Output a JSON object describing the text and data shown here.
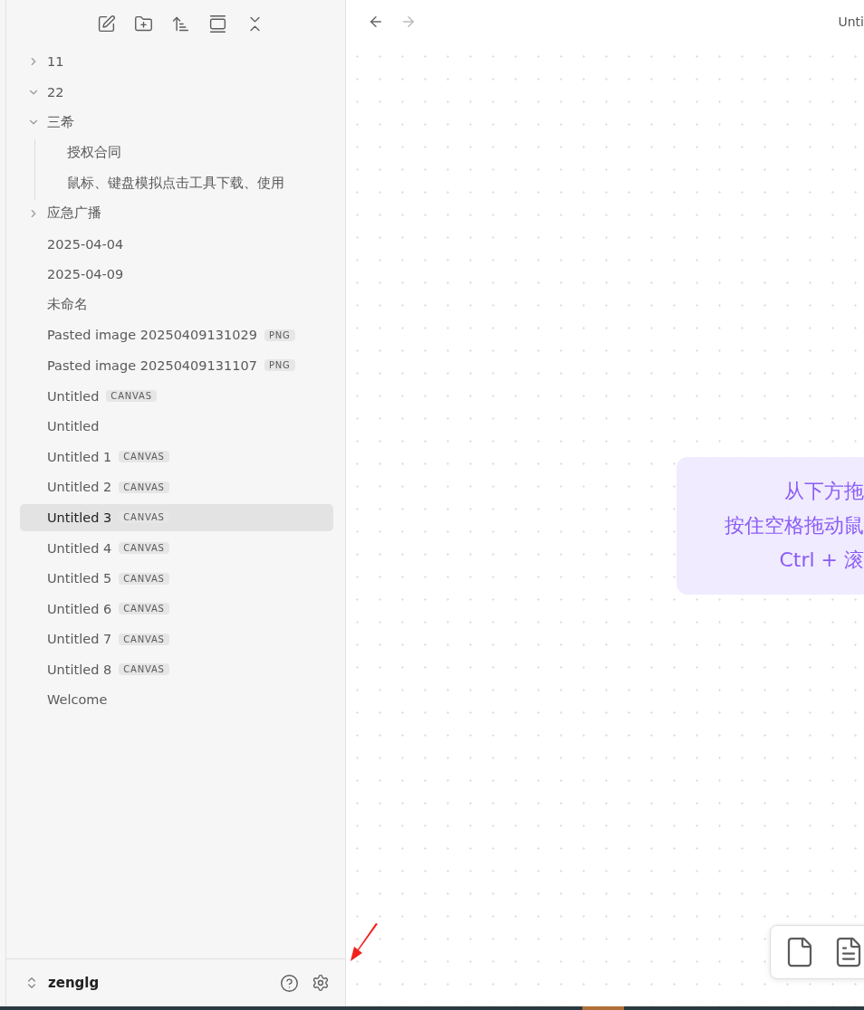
{
  "sidebar": {
    "tree": [
      {
        "kind": "folder",
        "name": "11",
        "expanded": false,
        "selected": false
      },
      {
        "kind": "folder",
        "name": "22",
        "expanded": true,
        "selected": false
      },
      {
        "kind": "folder",
        "name": "三希",
        "expanded": true,
        "selected": false,
        "children": [
          {
            "kind": "file",
            "name": "授权合同",
            "selected": false
          },
          {
            "kind": "file",
            "name": "鼠标、键盘模拟点击工具下载、使用",
            "selected": false
          }
        ]
      },
      {
        "kind": "folder",
        "name": "应急广播",
        "expanded": false,
        "selected": false
      },
      {
        "kind": "file",
        "name": "2025-04-04",
        "selected": false
      },
      {
        "kind": "file",
        "name": "2025-04-09",
        "selected": false
      },
      {
        "kind": "file",
        "name": "未命名",
        "selected": false
      },
      {
        "kind": "file",
        "name": "Pasted image 20250409131029",
        "badge": "PNG",
        "selected": false
      },
      {
        "kind": "file",
        "name": "Pasted image 20250409131107",
        "badge": "PNG",
        "selected": false
      },
      {
        "kind": "file",
        "name": "Untitled",
        "badge": "CANVAS",
        "selected": false
      },
      {
        "kind": "file",
        "name": "Untitled",
        "selected": false
      },
      {
        "kind": "file",
        "name": "Untitled 1",
        "badge": "CANVAS",
        "selected": false
      },
      {
        "kind": "file",
        "name": "Untitled 2",
        "badge": "CANVAS",
        "selected": false
      },
      {
        "kind": "file",
        "name": "Untitled 3",
        "badge": "CANVAS",
        "selected": true
      },
      {
        "kind": "file",
        "name": "Untitled 4",
        "badge": "CANVAS",
        "selected": false
      },
      {
        "kind": "file",
        "name": "Untitled 5",
        "badge": "CANVAS",
        "selected": false
      },
      {
        "kind": "file",
        "name": "Untitled 6",
        "badge": "CANVAS",
        "selected": false
      },
      {
        "kind": "file",
        "name": "Untitled 7",
        "badge": "CANVAS",
        "selected": false
      },
      {
        "kind": "file",
        "name": "Untitled 8",
        "badge": "CANVAS",
        "selected": false
      },
      {
        "kind": "file",
        "name": "Welcome",
        "selected": false
      }
    ],
    "vault": {
      "name": "zenglg"
    }
  },
  "main": {
    "nav": {
      "back_disabled": false,
      "forward_disabled": true
    },
    "tab_title": "Unti",
    "hint": [
      "从下方拖",
      "按住空格拖动鼠",
      "Ctrl + 滚"
    ]
  }
}
